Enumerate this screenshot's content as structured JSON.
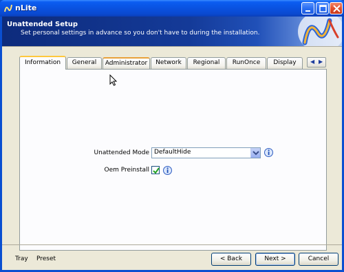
{
  "window": {
    "title": "nLite",
    "colors": {
      "titlebar": "#0a52e0",
      "close": "#e2502e",
      "accent_tab": "#ffc73c"
    }
  },
  "header": {
    "title": "Unattended Setup",
    "subtitle": "Set personal settings in advance so you don't have to during the installation.",
    "logo_icon": "nlite-logo-icon"
  },
  "tabs": [
    {
      "label": "Information",
      "state": "active"
    },
    {
      "label": "General",
      "state": "normal"
    },
    {
      "label": "Administrator",
      "state": "hover"
    },
    {
      "label": "Network",
      "state": "normal"
    },
    {
      "label": "Regional",
      "state": "normal"
    },
    {
      "label": "RunOnce",
      "state": "normal"
    },
    {
      "label": "Display",
      "state": "normal"
    }
  ],
  "tab_scroll": {
    "left": "◀",
    "right": "▶"
  },
  "form": {
    "unattended_mode_label": "Unattended Mode",
    "unattended_mode_value": "DefaultHide",
    "oem_preinstall_label": "Oem Preinstall",
    "oem_preinstall_checked": true,
    "info_icon": "info-icon"
  },
  "footer": {
    "tray": "Tray",
    "preset": "Preset",
    "back": "< Back",
    "next": "Next >",
    "cancel": "Cancel"
  }
}
